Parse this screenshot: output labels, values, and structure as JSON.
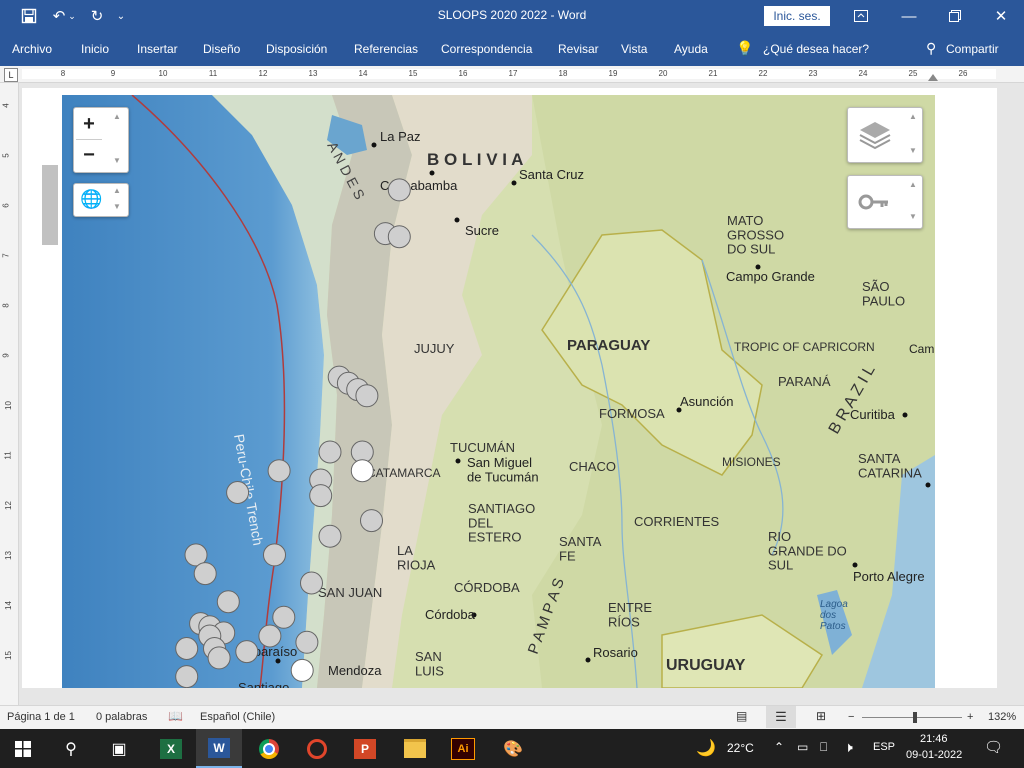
{
  "titlebar": {
    "document_title": "SLOOPS 2020 2022 - Word",
    "signin_label": "Inic. ses."
  },
  "ribbon": {
    "tabs": [
      "Archivo",
      "Inicio",
      "Insertar",
      "Diseño",
      "Disposición",
      "Referencias",
      "Correspondencia",
      "Revisar",
      "Vista",
      "Ayuda"
    ],
    "tell_me": "¿Qué desea hacer?",
    "share_label": "Compartir"
  },
  "ruler": {
    "corner_label": "L",
    "numbers": [
      "8",
      "9",
      "10",
      "11",
      "12",
      "13",
      "14",
      "15",
      "16",
      "17",
      "18",
      "19",
      "20",
      "21",
      "22",
      "23",
      "24",
      "25",
      "26"
    ],
    "vertical_numbers": [
      "4",
      "5",
      "6",
      "7",
      "8",
      "9",
      "10",
      "11",
      "12",
      "13",
      "14",
      "15"
    ]
  },
  "map": {
    "labels": {
      "la_paz": "La Paz",
      "bolivia": "B O L I V I A",
      "santa_cruz": "Santa Cruz",
      "cochabamba": "Cochabamba",
      "sucre": "Sucre",
      "andes": "A N D E S",
      "mato_grosso": "MATO\nGROSSO\nDO SUL",
      "campo_grande": "Campo Grande",
      "sao_paulo": "SÃO\nPAULO",
      "paraguay": "PARAGUAY",
      "tropic": "TROPIC OF CAPRICORN",
      "cam": "Cam",
      "jujuy": "JUJUY",
      "asuncion": "Asunción",
      "formosa": "FORMOSA",
      "parana": "PARANÁ",
      "curitiba": "Curitiba",
      "brazil": "B R A Z I L",
      "tucuman": "TUCUMÁN",
      "san_miguel": "San Miguel\nde Tucumán",
      "chaco": "CHACO",
      "misiones": "MISIONES",
      "santa_catarina": "SANTA\nCATARINA",
      "catamarca": "CATAMARCA",
      "santiago_estero": "SANTIAGO\nDEL\nESTERO",
      "corrientes": "CORRIENTES",
      "rio_grande": "RIO\nGRANDE DO\nSUL",
      "la_rioja": "LA\nRIOJA",
      "santa_fe": "SANTA\nFE",
      "porto_alegre": "Porto Alegre",
      "cordoba_prov": "CÓRDOBA",
      "san_juan": "SAN JUAN",
      "cordoba": "Córdoba",
      "entre_rios": "ENTRE\nRÍOS",
      "lagoa": "Lagoa\ndos\nPatos",
      "valparaiso": "Valparaíso",
      "rosario": "Rosario",
      "uruguay": "URUGUAY",
      "mendoza": "Mendoza",
      "santiago": "Santiago",
      "san_luis": "SAN\nLUIS",
      "trench": "Peru-Chile Trench",
      "pampas": "P A M P A S",
      "mato_partial": "FE\nla"
    },
    "zoom_in": "+",
    "zoom_out": "−",
    "markers": [
      {
        "lon": -63.3,
        "lat": -17.6
      },
      {
        "lon": -63.6,
        "lat": -19.0
      },
      {
        "lon": -63.3,
        "lat": -19.1
      },
      {
        "lon": -64.6,
        "lat": -23.6
      },
      {
        "lon": -64.4,
        "lat": -23.8
      },
      {
        "lon": -64.2,
        "lat": -24.0
      },
      {
        "lon": -64.0,
        "lat": -24.2
      },
      {
        "lon": -64.8,
        "lat": -26.0
      },
      {
        "lon": -64.1,
        "lat": -26.0
      },
      {
        "lon": -64.1,
        "lat": -26.6,
        "white": true
      },
      {
        "lon": -65.9,
        "lat": -26.6
      },
      {
        "lon": -65.0,
        "lat": -26.9
      },
      {
        "lon": -65.0,
        "lat": -27.4
      },
      {
        "lon": -66.8,
        "lat": -27.3
      },
      {
        "lon": -63.9,
        "lat": -28.2
      },
      {
        "lon": -64.8,
        "lat": -28.7
      },
      {
        "lon": -67.7,
        "lat": -29.3
      },
      {
        "lon": -66.0,
        "lat": -29.3
      },
      {
        "lon": -67.5,
        "lat": -29.9
      },
      {
        "lon": -65.2,
        "lat": -30.2
      },
      {
        "lon": -67.0,
        "lat": -30.8
      },
      {
        "lon": -65.8,
        "lat": -31.3
      },
      {
        "lon": -67.6,
        "lat": -31.5
      },
      {
        "lon": -67.4,
        "lat": -31.6
      },
      {
        "lon": -67.1,
        "lat": -31.8
      },
      {
        "lon": -66.1,
        "lat": -31.9
      },
      {
        "lon": -67.4,
        "lat": -31.9
      },
      {
        "lon": -65.3,
        "lat": -32.1
      },
      {
        "lon": -67.9,
        "lat": -32.3
      },
      {
        "lon": -67.3,
        "lat": -32.3
      },
      {
        "lon": -66.6,
        "lat": -32.4
      },
      {
        "lon": -67.2,
        "lat": -32.6
      },
      {
        "lon": -65.4,
        "lat": -33.0,
        "white": true
      },
      {
        "lon": -67.9,
        "lat": -33.2
      }
    ]
  },
  "status": {
    "page": "Página 1 de 1",
    "words": "0 palabras",
    "language": "Español (Chile)",
    "zoom": "132%"
  },
  "taskbar": {
    "temperature": "22°C",
    "lang": "ESP",
    "time": "21:46",
    "date": "09-01-2022"
  }
}
